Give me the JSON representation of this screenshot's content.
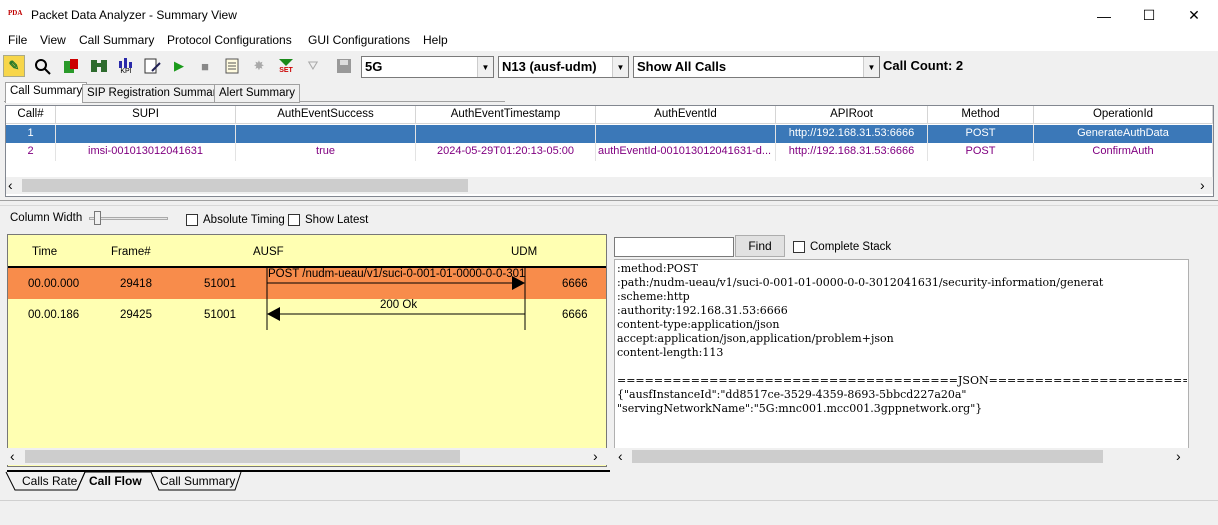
{
  "window": {
    "title": "Packet Data Analyzer - Summary View",
    "logo_text": "PDA",
    "minimize": "—",
    "maximize": "☐",
    "close": "✕"
  },
  "menu": [
    "File",
    "View",
    "Call Summary",
    "Protocol Configurations",
    "GUI Configurations",
    "Help"
  ],
  "toolbar": {
    "icons": [
      "filter-icon",
      "search-icon",
      "export-icon",
      "binoculars-icon",
      "kpi-icon",
      "edit-icon",
      "play-icon",
      "stop-icon",
      "notes-icon",
      "disabled-icon",
      "set-icon",
      "funnel-icon",
      "save-icon"
    ],
    "kpi_label": "KPI",
    "set_label": "SET",
    "combo_network": "5G",
    "combo_interface": "N13 (ausf-udm)",
    "combo_calls": "Show All Calls",
    "call_count": "Call Count: 2"
  },
  "top_tabs": [
    "Call Summary",
    "SIP Registration Summary",
    "Alert Summary"
  ],
  "grid": {
    "columns": [
      "Call#",
      "SUPI",
      "AuthEventSuccess",
      "AuthEventTimestamp",
      "AuthEventId",
      "APIRoot",
      "Method",
      "OperationId"
    ],
    "rows": [
      [
        "1",
        "",
        "",
        "",
        "",
        "http://192.168.31.53:6666",
        "POST",
        "GenerateAuthData"
      ],
      [
        "2",
        "imsi-001013012041631",
        "true",
        "2024-05-29T01:20:13-05:00",
        "authEventId-001013012041631-d...",
        "http://192.168.31.53:6666",
        "POST",
        "ConfirmAuth"
      ]
    ],
    "scroll_left": "‹",
    "scroll_right": "›"
  },
  "options": {
    "column_width_label": "Column Width",
    "absolute_timing_label": "Absolute Timing",
    "show_latest_label": "Show Latest"
  },
  "flow": {
    "headers": {
      "time": "Time",
      "frame": "Frame#",
      "ausf": "AUSF",
      "udm": "UDM"
    },
    "rows": [
      {
        "time": "00.00.000",
        "frame": "29418",
        "src_port": "51001",
        "msg": "POST /nudm-ueau/v1/suci-0-001-01-0000-0-0-3012",
        "dst_port": "6666"
      },
      {
        "time": "00.00.186",
        "frame": "29425",
        "src_port": "51001",
        "msg": "200 Ok",
        "dst_port": "6666"
      }
    ],
    "highlight_color": "#f88c4b",
    "background_color": "#ffffb2"
  },
  "detail": {
    "find_label": "Find",
    "find_value": "",
    "complete_stack_label": "Complete Stack",
    "lines": [
      ":method:POST",
      ":path:/nudm-ueau/v1/suci-0-001-01-0000-0-0-3012041631/security-information/generat",
      ":scheme:http",
      ":authority:192.168.31.53:6666",
      "content-type:application/json",
      "accept:application/json,application/problem+json",
      "content-length:113",
      "",
      "=====================================JSON==================================",
      "{\"ausfInstanceId\":\"dd8517ce-3529-4359-8693-5bbcd227a20a\"",
      "\"servingNetworkName\":\"5G:mnc001.mcc001.3gppnetwork.org\"}"
    ]
  },
  "bottom_tabs": [
    "Calls Rate",
    "Call Flow",
    "Call Summary"
  ],
  "colors": {
    "selected_row": "#3b78b8",
    "row_text": "#800080"
  }
}
